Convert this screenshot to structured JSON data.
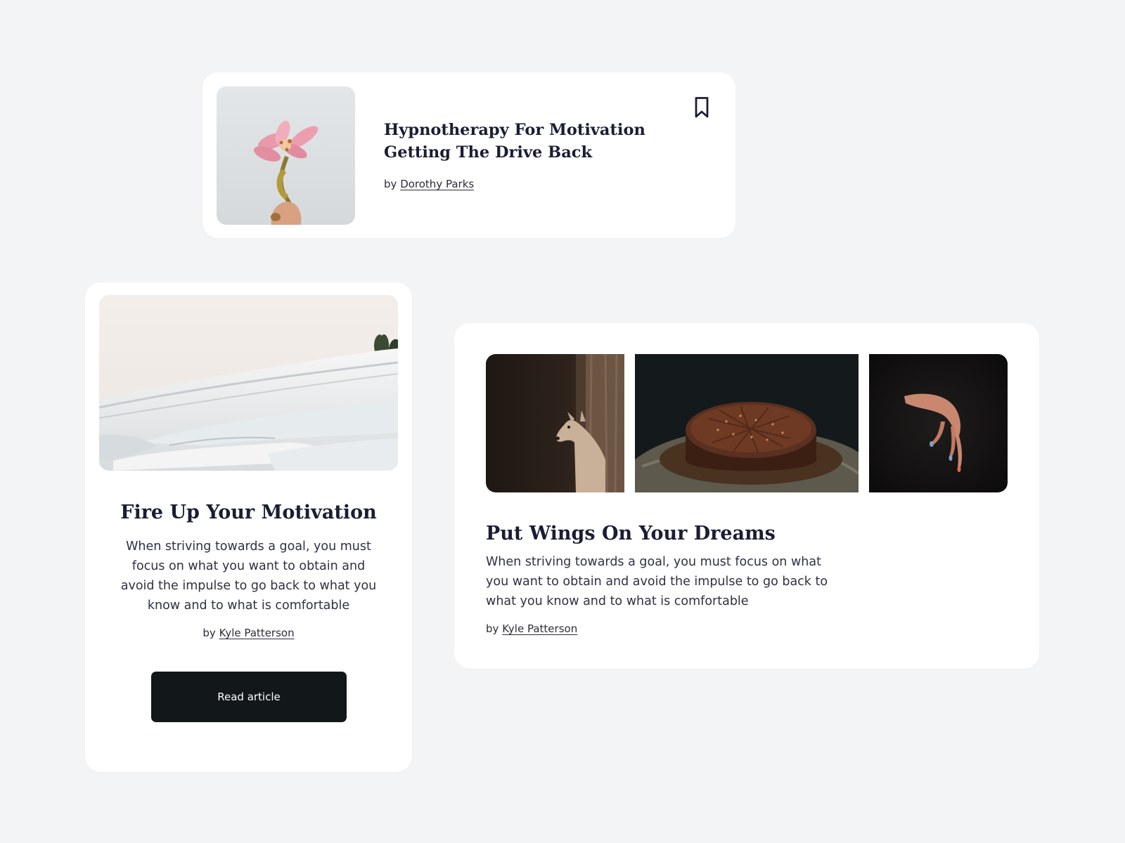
{
  "articles": {
    "hypnotherapy": {
      "title": "Hypnotherapy For Motivation Getting The Drive Back",
      "by_prefix": "by",
      "author": "Dorothy Parks",
      "image": "pink-lily-flower-in-hand",
      "bookmark_icon": "bookmark-icon"
    },
    "fire_up": {
      "title": "Fire Up Your Motivation",
      "description": "When striving towards a goal, you must focus on what you want to obtain and avoid the impulse to go back to what you know and to what is comfortable",
      "by_prefix": "by",
      "author": "Kyle Patterson",
      "button_label": "Read article",
      "image": "snowy-terraces-landscape"
    },
    "wings": {
      "title": "Put Wings On Your Dreams",
      "description": "When striving towards a goal, you must focus on what you want to obtain and avoid the impulse to go back to what you know and to what is comfortable",
      "by_prefix": "by",
      "author": "Kyle Patterson",
      "images": [
        "deer-behind-tree",
        "chocolate-cake",
        "hand-with-painted-nails"
      ]
    }
  },
  "colors": {
    "page_background": "#f3f4f6",
    "card_background": "#ffffff",
    "heading": "#1b1d33",
    "button": "#121719",
    "button_text": "#ffffff"
  }
}
